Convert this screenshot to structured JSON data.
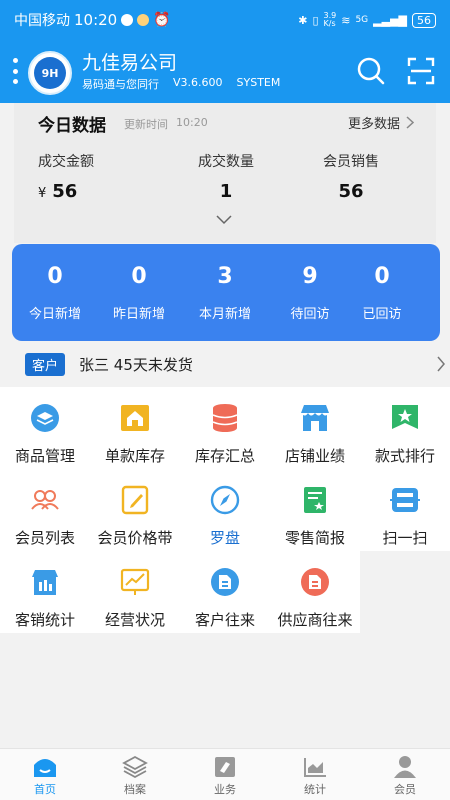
{
  "status_bar": {
    "carrier": "中国移动",
    "time": "10:20",
    "net_speed": "3.9\nK/s",
    "network": "5G",
    "battery": "56"
  },
  "app": {
    "company": "九佳易公司",
    "logo_text": "9H",
    "slogan": "易码通与您同行",
    "version": "V3.6.600",
    "mode": "SYSTEM"
  },
  "today": {
    "title": "今日数据",
    "update_label": "更新时间",
    "update_time": "10:20",
    "more": "更多数据",
    "stats": [
      {
        "label": "成交金额",
        "currency": "¥",
        "value": "56"
      },
      {
        "label": "成交数量",
        "value": "1"
      },
      {
        "label": "会员销售",
        "value": "56"
      }
    ]
  },
  "customers": [
    {
      "value": "0",
      "label": "今日新增"
    },
    {
      "value": "0",
      "label": "昨日新增"
    },
    {
      "value": "3",
      "label": "本月新增"
    },
    {
      "value": "9",
      "label": "待回访"
    },
    {
      "value": "0",
      "label": "已回访"
    }
  ],
  "notice": {
    "tag": "客户",
    "text": "张三 45天未发货"
  },
  "menu": [
    {
      "label": "商品管理",
      "icon": "layers-icon",
      "color": "#3a9be6"
    },
    {
      "label": "单款库存",
      "icon": "warehouse-icon",
      "color": "#f1b422"
    },
    {
      "label": "库存汇总",
      "icon": "database-icon",
      "color": "#ef6b57"
    },
    {
      "label": "店铺业绩",
      "icon": "shop-icon",
      "color": "#3a9be6"
    },
    {
      "label": "款式排行",
      "icon": "star-badge-icon",
      "color": "#2fb569"
    },
    {
      "label": "会员列表",
      "icon": "members-icon",
      "color": "#f07a5a"
    },
    {
      "label": "会员价格带",
      "icon": "edit-note-icon",
      "color": "#f1b422"
    },
    {
      "label": "罗盘",
      "icon": "compass-icon",
      "color": "#3a9be6",
      "highlight": true
    },
    {
      "label": "零售简报",
      "icon": "report-icon",
      "color": "#2fb569"
    },
    {
      "label": "扫一扫",
      "icon": "scan-icon",
      "color": "#3a9be6"
    },
    {
      "label": "客销统计",
      "icon": "store-stats-icon",
      "color": "#3a9be6"
    },
    {
      "label": "经营状况",
      "icon": "trend-board-icon",
      "color": "#f1b422"
    },
    {
      "label": "客户往来",
      "icon": "customer-exchange-icon",
      "color": "#3a9be6"
    },
    {
      "label": "供应商往来",
      "icon": "supplier-exchange-icon",
      "color": "#ef6b57"
    }
  ],
  "nav": [
    {
      "label": "首页",
      "icon": "home-icon",
      "active": true
    },
    {
      "label": "档案",
      "icon": "archive-icon"
    },
    {
      "label": "业务",
      "icon": "business-icon"
    },
    {
      "label": "统计",
      "icon": "stats-icon"
    },
    {
      "label": "会员",
      "icon": "member-icon"
    }
  ],
  "colors": {
    "primary": "#1a97f0",
    "card_blue": "#3a82ef",
    "tag": "#1a6fd0"
  }
}
